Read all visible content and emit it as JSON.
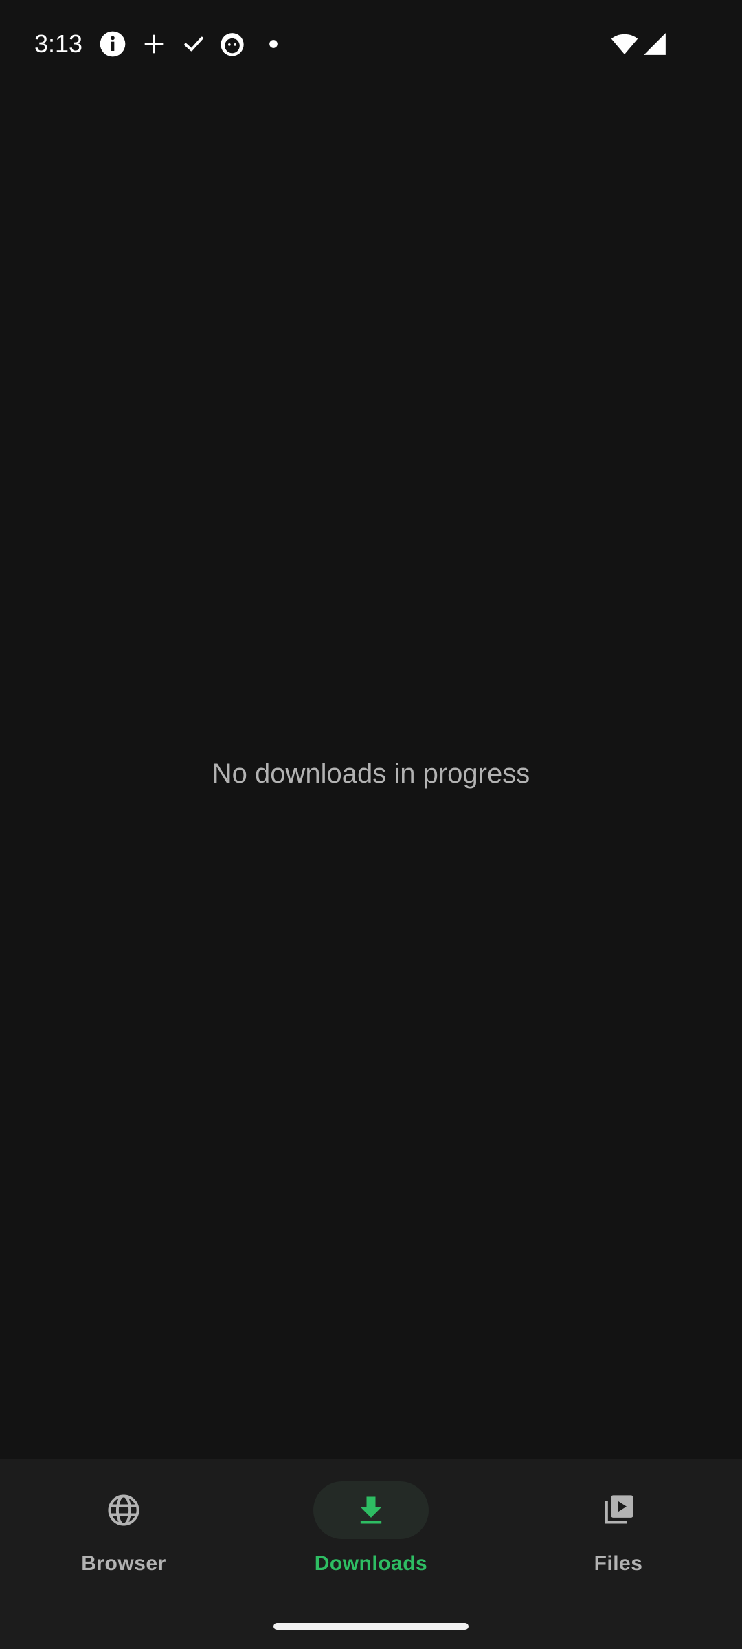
{
  "status_bar": {
    "time": "3:13",
    "icons": [
      "info-icon",
      "plus-icon",
      "check-icon",
      "cat-face-icon",
      "dot-icon",
      "wifi-icon",
      "cell-signal-icon"
    ]
  },
  "main": {
    "empty_message": "No downloads in progress"
  },
  "bottom_nav": {
    "items": [
      {
        "label": "Browser",
        "icon": "globe-icon",
        "active": false
      },
      {
        "label": "Downloads",
        "icon": "download-icon",
        "active": true
      },
      {
        "label": "Files",
        "icon": "video-library-icon",
        "active": false
      }
    ]
  },
  "colors": {
    "background": "#131313",
    "nav_background": "#1c1c1c",
    "accent": "#2ebd63",
    "inactive": "#b3b3b3",
    "active_indicator": "#242a26"
  }
}
